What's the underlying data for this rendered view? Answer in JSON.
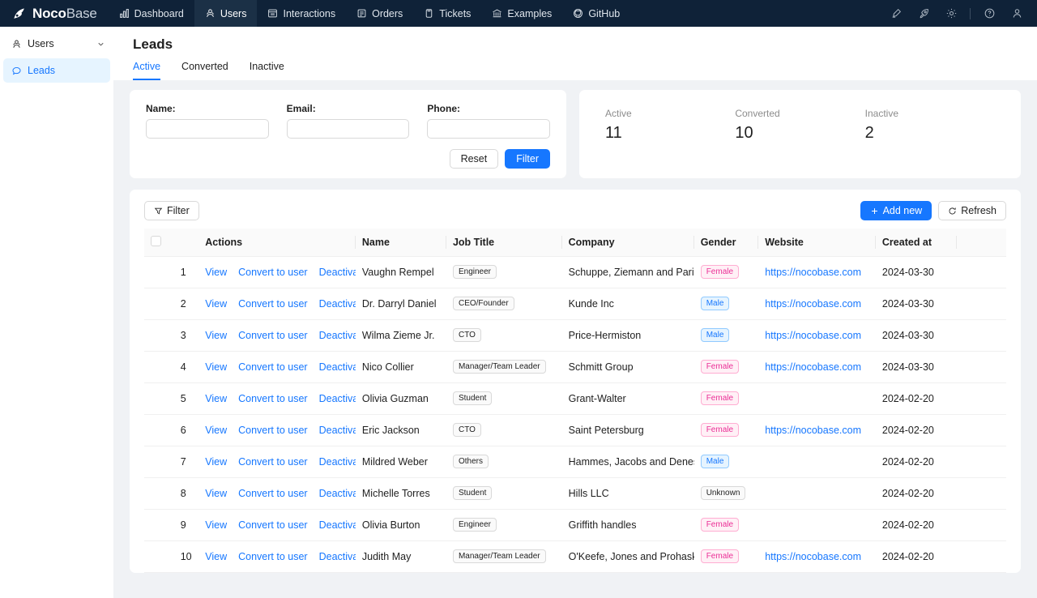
{
  "topnav": {
    "brand": {
      "bold": "Noco",
      "light": "Base",
      "logo_icon": "nocobase-logo-icon"
    },
    "items": [
      {
        "label": "Dashboard",
        "icon": "chart-bar-icon",
        "active": false
      },
      {
        "label": "Users",
        "icon": "users-icon",
        "active": true
      },
      {
        "label": "Interactions",
        "icon": "window-icon",
        "active": false
      },
      {
        "label": "Orders",
        "icon": "form-icon",
        "active": false
      },
      {
        "label": "Tickets",
        "icon": "ticket-icon",
        "active": false
      },
      {
        "label": "Examples",
        "icon": "bank-icon",
        "active": false
      },
      {
        "label": "GitHub",
        "icon": "github-icon",
        "active": false
      }
    ],
    "right_icons": [
      {
        "name": "highlighter-icon"
      },
      {
        "name": "plugin-rocket-icon"
      },
      {
        "name": "gear-icon"
      },
      {
        "name": "help-circle-icon"
      },
      {
        "name": "user-avatar-icon"
      }
    ]
  },
  "sidebar": {
    "group": {
      "label": "Users",
      "icon": "users-icon",
      "chevron": "chevron-down-icon"
    },
    "items": [
      {
        "label": "Leads",
        "icon": "comment-icon",
        "active": true
      }
    ]
  },
  "page": {
    "title": "Leads",
    "tabs": [
      {
        "label": "Active",
        "active": true
      },
      {
        "label": "Converted",
        "active": false
      },
      {
        "label": "Inactive",
        "active": false
      }
    ]
  },
  "filter_form": {
    "fields": [
      {
        "label": "Name:",
        "value": "",
        "placeholder": ""
      },
      {
        "label": "Email:",
        "value": "",
        "placeholder": ""
      },
      {
        "label": "Phone:",
        "value": "",
        "placeholder": ""
      }
    ],
    "reset_label": "Reset",
    "filter_label": "Filter"
  },
  "stats": [
    {
      "label": "Active",
      "value": "11"
    },
    {
      "label": "Converted",
      "value": "10"
    },
    {
      "label": "Inactive",
      "value": "2"
    }
  ],
  "table_toolbar": {
    "filter_label": "Filter",
    "filter_icon": "funnel-icon",
    "add_new_label": "Add new",
    "add_new_icon": "plus-icon",
    "refresh_label": "Refresh",
    "refresh_icon": "refresh-icon"
  },
  "table": {
    "columns": [
      "",
      "Actions",
      "Name",
      "Job Title",
      "Company",
      "Gender",
      "Website",
      "Created at",
      ""
    ],
    "actions": [
      "View",
      "Convert to user",
      "Deactivate"
    ],
    "rows": [
      {
        "idx": "1",
        "name": "Vaughn Rempel",
        "job": "Engineer",
        "company": "Schuppe, Ziemann and Parisian",
        "gender": "Female",
        "gender_kind": "female",
        "website": "https://nocobase.com",
        "created": "2024-03-30"
      },
      {
        "idx": "2",
        "name": "Dr. Darryl Daniel",
        "job": "CEO/Founder",
        "company": "Kunde Inc",
        "gender": "Male",
        "gender_kind": "male",
        "website": "https://nocobase.com",
        "created": "2024-03-30"
      },
      {
        "idx": "3",
        "name": "Wilma Zieme Jr.",
        "job": "CTO",
        "company": "Price-Hermiston",
        "gender": "Male",
        "gender_kind": "male",
        "website": "https://nocobase.com",
        "created": "2024-03-30"
      },
      {
        "idx": "4",
        "name": "Nico Collier",
        "job": "Manager/Team Leader",
        "company": "Schmitt Group",
        "gender": "Female",
        "gender_kind": "female",
        "website": "https://nocobase.com",
        "created": "2024-03-30"
      },
      {
        "idx": "5",
        "name": "Olivia Guzman",
        "job": "Student",
        "company": "Grant-Walter",
        "gender": "Female",
        "gender_kind": "female",
        "website": "",
        "created": "2024-02-20"
      },
      {
        "idx": "6",
        "name": "Eric Jackson",
        "job": "CTO",
        "company": "Saint Petersburg",
        "gender": "Female",
        "gender_kind": "female",
        "website": "https://nocobase.com",
        "created": "2024-02-20"
      },
      {
        "idx": "7",
        "name": "Mildred Weber",
        "job": "Others",
        "company": "Hammes, Jacobs and Denesik",
        "gender": "Male",
        "gender_kind": "male",
        "website": "",
        "created": "2024-02-20"
      },
      {
        "idx": "8",
        "name": "Michelle Torres",
        "job": "Student",
        "company": "Hills LLC",
        "gender": "Unknown",
        "gender_kind": "unknown",
        "website": "",
        "created": "2024-02-20"
      },
      {
        "idx": "9",
        "name": "Olivia Burton",
        "job": "Engineer",
        "company": "Griffith handles",
        "gender": "Female",
        "gender_kind": "female",
        "website": "",
        "created": "2024-02-20"
      },
      {
        "idx": "10",
        "name": "Judith May",
        "job": "Manager/Team Leader",
        "company": "O'Keefe, Jones and Prohaska",
        "gender": "Female",
        "gender_kind": "female",
        "website": "https://nocobase.com",
        "created": "2024-02-20"
      }
    ]
  },
  "colors": {
    "nav_bg": "#0f2238",
    "nav_active_bg": "#1b3046",
    "accent": "#1677ff",
    "page_bg": "#f0f2f5",
    "female": "#eb2f96",
    "male": "#1677ff"
  }
}
